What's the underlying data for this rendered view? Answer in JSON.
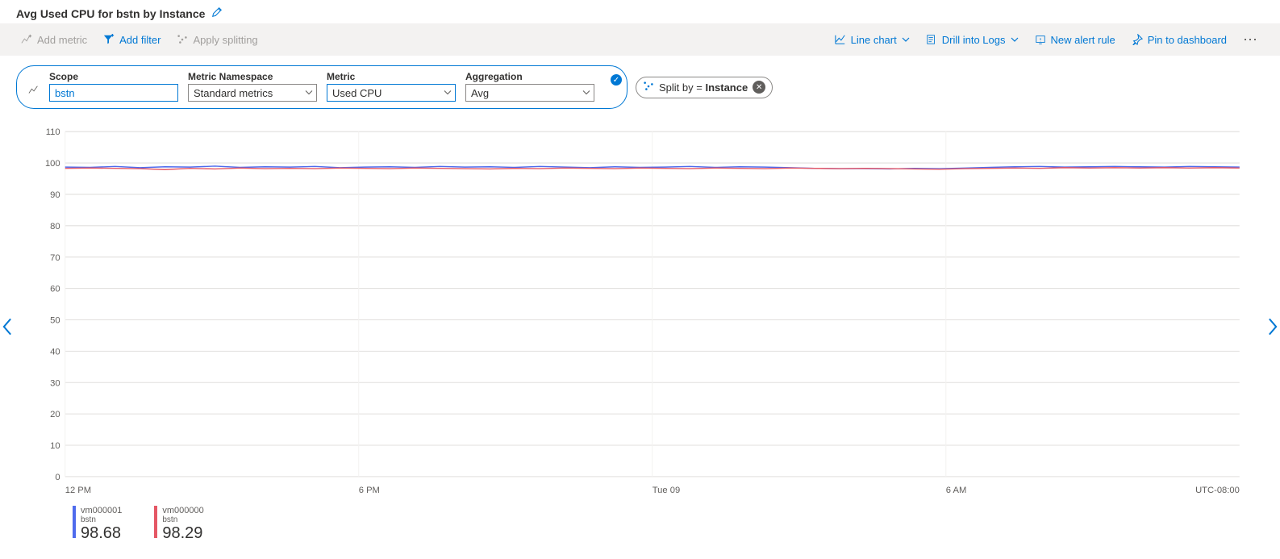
{
  "header": {
    "title": "Avg Used CPU for bstn by Instance"
  },
  "toolbar": {
    "add_metric": "Add metric",
    "add_filter": "Add filter",
    "apply_splitting": "Apply splitting",
    "line_chart": "Line chart",
    "drill_logs": "Drill into Logs",
    "new_alert": "New alert rule",
    "pin_dash": "Pin to dashboard"
  },
  "config": {
    "scope_label": "Scope",
    "scope_value": "bstn",
    "ns_label": "Metric Namespace",
    "ns_value": "Standard metrics",
    "metric_label": "Metric",
    "metric_value": "Used CPU",
    "agg_label": "Aggregation",
    "agg_value": "Avg",
    "split_prefix": "Split by = ",
    "split_value": "Instance"
  },
  "legend": [
    {
      "name": "vm000001",
      "sub": "bstn",
      "value": "98.68",
      "color": "#4f6bed"
    },
    {
      "name": "vm000000",
      "sub": "bstn",
      "value": "98.29",
      "color": "#e55765"
    }
  ],
  "chart_data": {
    "type": "line",
    "xlabel": "",
    "ylabel": "",
    "ylim": [
      0,
      110
    ],
    "yticks": [
      0,
      10,
      20,
      30,
      40,
      50,
      60,
      70,
      80,
      90,
      100,
      110
    ],
    "x_categories": [
      "12 PM",
      "6 PM",
      "Tue 09",
      "6 AM"
    ],
    "timezone_label": "UTC-08:00",
    "series": [
      {
        "name": "vm000001",
        "color": "#4f6bed",
        "values": [
          98.7,
          98.6,
          98.9,
          98.5,
          98.8,
          98.7,
          99.0,
          98.6,
          98.8,
          98.7,
          98.9,
          98.5,
          98.7,
          98.8,
          98.6,
          98.9,
          98.7,
          98.8,
          98.6,
          98.9,
          98.7,
          98.5,
          98.8,
          98.6,
          98.7,
          98.9,
          98.6,
          98.8,
          98.7,
          98.5,
          98.3,
          98.2,
          98.2,
          98.1,
          98.3,
          98.2,
          98.4,
          98.6,
          98.8,
          98.9,
          98.7,
          98.8,
          98.9,
          98.8,
          98.7,
          98.9,
          98.8,
          98.7
        ]
      },
      {
        "name": "vm000000",
        "color": "#e55765",
        "values": [
          98.3,
          98.4,
          98.3,
          98.2,
          97.9,
          98.3,
          98.1,
          98.4,
          98.2,
          98.3,
          98.2,
          98.4,
          98.3,
          98.2,
          98.4,
          98.3,
          98.2,
          98.1,
          98.3,
          98.2,
          98.4,
          98.3,
          98.2,
          98.4,
          98.3,
          98.2,
          98.4,
          98.3,
          98.2,
          98.4,
          98.3,
          98.2,
          98.3,
          98.2,
          98.1,
          98.0,
          98.2,
          98.3,
          98.4,
          98.3,
          98.5,
          98.4,
          98.5,
          98.4,
          98.5,
          98.4,
          98.5,
          98.4
        ]
      }
    ]
  }
}
